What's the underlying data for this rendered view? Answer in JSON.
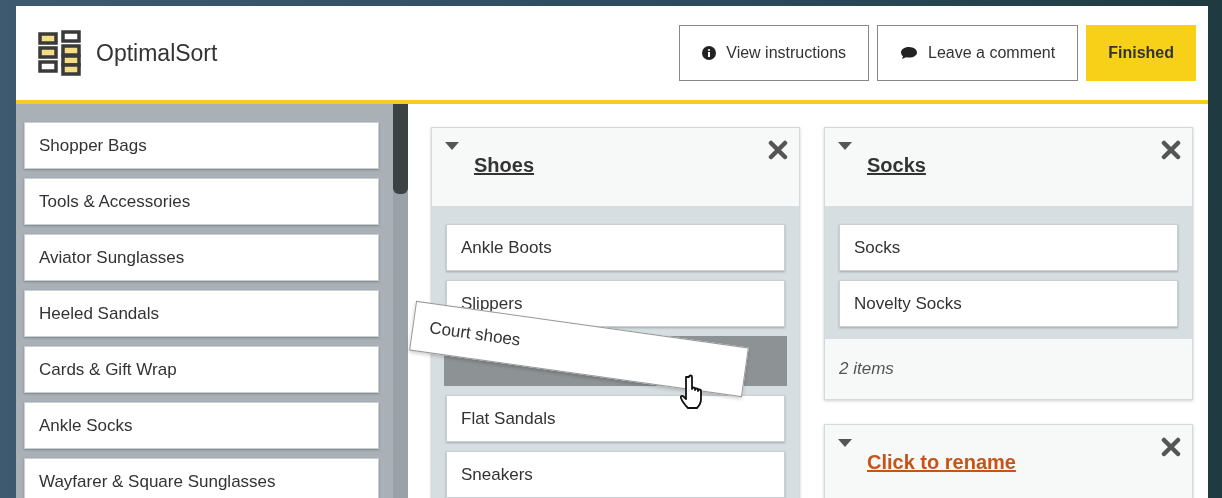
{
  "app": {
    "name": "OptimalSort"
  },
  "toolbar": {
    "buttons": [
      {
        "label": "View instructions",
        "kind": "info"
      },
      {
        "label": "Leave a comment",
        "kind": "comment"
      },
      {
        "label": "Finished",
        "kind": "primary"
      }
    ]
  },
  "cards": [
    {
      "label": "Shopper Bags"
    },
    {
      "label": "Tools & Accessories"
    },
    {
      "label": "Aviator Sunglasses"
    },
    {
      "label": "Heeled Sandals"
    },
    {
      "label": "Cards & Gift Wrap"
    },
    {
      "label": "Ankle Socks"
    },
    {
      "label": "Wayfarer & Square Sunglasses"
    }
  ],
  "columns": [
    {
      "categories": [
        {
          "title": "Shoes",
          "named": true,
          "items": [
            {
              "kind": "card",
              "label": "Ankle Boots"
            },
            {
              "kind": "card",
              "label": "Slippers"
            },
            {
              "kind": "slot"
            },
            {
              "kind": "card",
              "label": "Flat Sandals"
            },
            {
              "kind": "card",
              "label": "Sneakers"
            }
          ]
        }
      ]
    },
    {
      "categories": [
        {
          "title": "Socks",
          "named": true,
          "items": [
            {
              "kind": "card",
              "label": "Socks"
            },
            {
              "kind": "card",
              "label": "Novelty Socks"
            }
          ],
          "footer": "2 items"
        },
        {
          "title": "Click to rename",
          "named": false
        }
      ]
    }
  ],
  "dragged_card": {
    "label": "Court shoes"
  }
}
